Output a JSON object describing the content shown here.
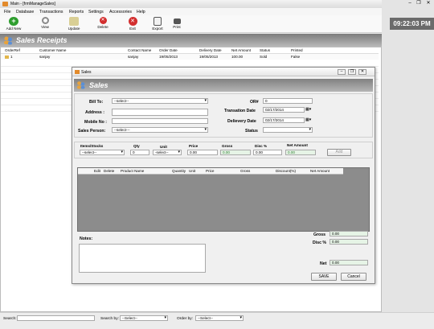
{
  "window": {
    "title": "Main - [frmManageSales]"
  },
  "menu": [
    "File",
    "Database",
    "Transactions",
    "Reports",
    "Settings",
    "Accessories",
    "Help"
  ],
  "toolbar": [
    {
      "label": "Add New",
      "icon": "add-icon",
      "color": "#2e9e2e"
    },
    {
      "label": "View",
      "icon": "search-icon",
      "color": "#9a9a9a"
    },
    {
      "label": "Update",
      "icon": "edit-icon",
      "color": "#c7b96a"
    },
    {
      "label": "Delete",
      "icon": "delete-icon",
      "color": "#d32f2f"
    },
    {
      "label": "Exit",
      "icon": "exit-icon",
      "color": "#d32f2f"
    },
    {
      "label": "Export",
      "icon": "export-icon",
      "color": "#4a7a4a"
    },
    {
      "label": "Print",
      "icon": "print-icon",
      "color": "#555555"
    }
  ],
  "header": {
    "title": "Sales Receipts"
  },
  "clock": "09:22:03 PM",
  "table": {
    "columns": [
      "OrderRef",
      "Customer Name",
      "Contact Name",
      "Order Date",
      "Delivery Date",
      "Net Amount",
      "Status",
      "Printed"
    ],
    "rows": [
      [
        "1",
        "sanjay",
        "sanjay",
        "19/05/2013",
        "19/05/2013",
        "100.00",
        "Sold",
        "False"
      ]
    ]
  },
  "bottom": {
    "search_label": "Search:",
    "searchby_label": "Search by:",
    "searchby_value": "--Select--",
    "orderby_label": "Order by:",
    "orderby_value": "--Select--"
  },
  "dialog": {
    "title": "Sales",
    "header": "Sales",
    "bill_to_label": "Bill To:",
    "bill_to_value": "--select--",
    "address_label": "Address :",
    "mobile_label": "Mobile No :",
    "salesperson_label": "Sales Person:",
    "salesperson_value": "--select---",
    "or_label": "OR#",
    "or_value": "0",
    "transaction_label": "Transation Date",
    "transaction_value": "02/17/2014",
    "delivery_label": "Delievery Date",
    "delivery_value": "02/17/2014",
    "status_label": "Status",
    "items_label": "Items/Stocks",
    "items_value": "--select--",
    "qty_label": "Qty",
    "qty_value": "0",
    "unit_label": "Unit",
    "unit_value": "-select--",
    "price_label": "Price",
    "price_value": "0.00",
    "gross_label": "Gross",
    "gross_value": "0.00",
    "disc_label": "Disc %",
    "disc_value": "0.00",
    "netamt_label": "Net Amount",
    "netamt_value": "0.00",
    "add_label": "Add",
    "grid_columns": [
      "Edit",
      "Delete",
      "Product Name",
      "Quantity",
      "Unit",
      "Price",
      "Gross",
      "Discount(%)",
      "Net Amount"
    ],
    "notes_label": "Notes:",
    "sum_gross_label": "Gross",
    "sum_gross_value": "0.00",
    "sum_disc_label": "Disc %",
    "sum_disc_value": "0.00",
    "sum_net_label": "Net",
    "sum_net_value": "0.00",
    "save_label": "SAVE",
    "cancel_label": "Cancel"
  }
}
